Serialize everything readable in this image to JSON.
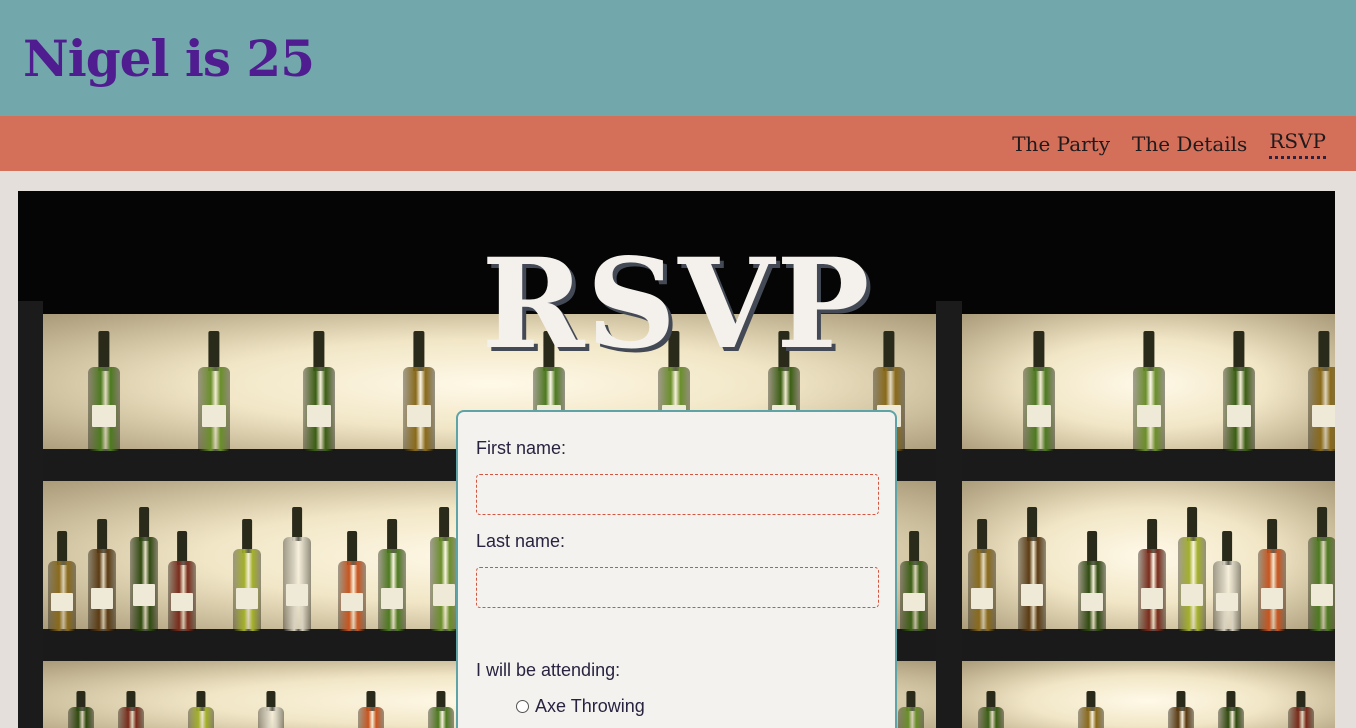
{
  "header": {
    "title": "Nigel is 25"
  },
  "nav": {
    "items": [
      {
        "label": "The Party"
      },
      {
        "label": "The Details"
      },
      {
        "label": "RSVP",
        "active": true
      }
    ]
  },
  "hero": {
    "title": "RSVP"
  },
  "form": {
    "first_name_label": "First name:",
    "first_name_value": "",
    "last_name_label": "Last name:",
    "last_name_value": "",
    "attending_label": "I will be attending:",
    "options": [
      {
        "label": "Axe Throwing",
        "checked": false
      }
    ]
  },
  "colors": {
    "header_bg": "#72a8ab",
    "title": "#4f1d8f",
    "nav_bg": "#d46f59",
    "page_bg": "#e4dfdb",
    "card_border": "#5ea3a6",
    "input_border": "#d6553e"
  }
}
